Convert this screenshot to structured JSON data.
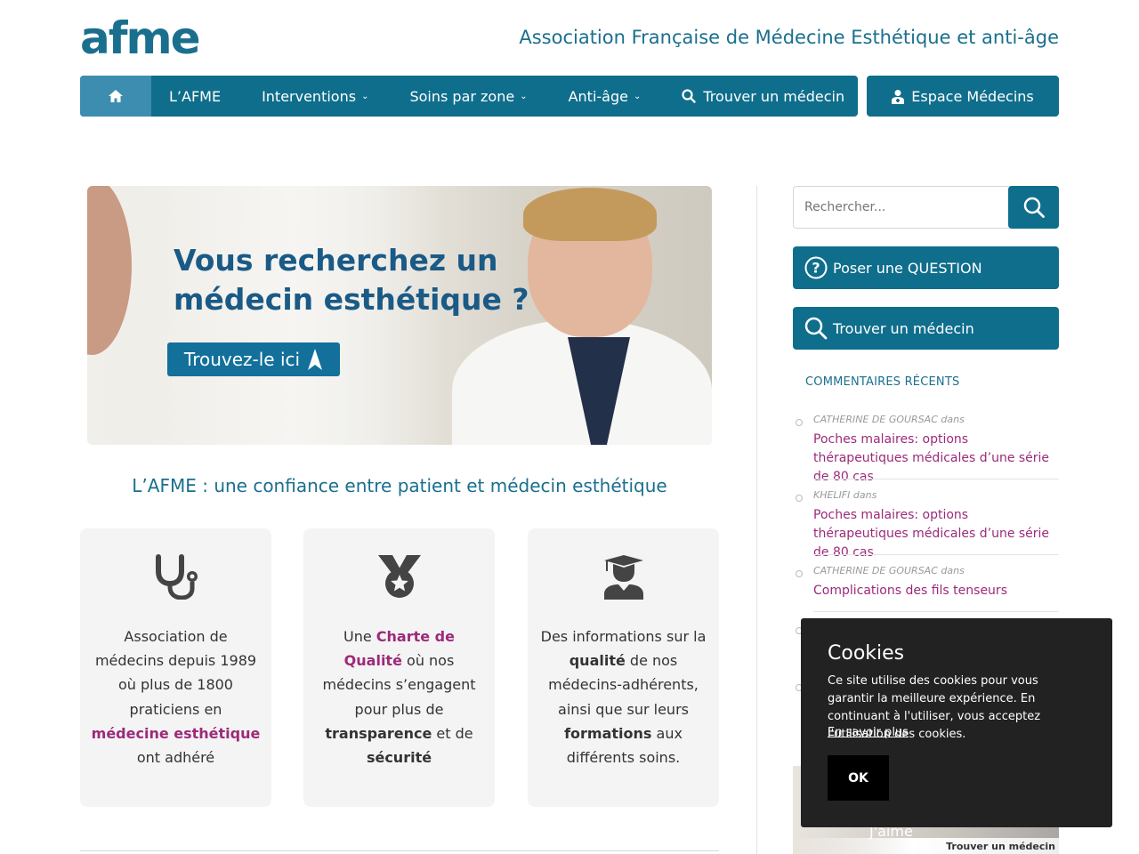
{
  "header": {
    "logo": "afme",
    "tagline": "Association Française de Médecine Esthétique et anti-âge"
  },
  "nav": {
    "items": [
      {
        "label": "L’AFME",
        "dropdown": false
      },
      {
        "label": "Interventions",
        "dropdown": true
      },
      {
        "label": "Soins par zone",
        "dropdown": true
      },
      {
        "label": "Anti-âge",
        "dropdown": true
      },
      {
        "label": "Trouver un médecin",
        "dropdown": false
      }
    ],
    "espace": "Espace Médecins"
  },
  "banner": {
    "title_line1": "Vous recherchez un",
    "title_line2": "médecin esthétique ?",
    "button": "Trouvez-le ici"
  },
  "subhead": "L’AFME : une confiance entre patient et médecin esthétique",
  "features": [
    {
      "icon": "stethoscope-icon"
    },
    {
      "icon": "medal-icon"
    },
    {
      "icon": "graduate-icon"
    }
  ],
  "sidebar": {
    "search_placeholder": "Rechercher...",
    "question_button": "Poser une QUESTION",
    "find_button": "Trouver un médecin",
    "recent_title": "COMMENTAIRES RÉCENTS",
    "comments": [
      {
        "author": "CATHERINE DE GOURSAC dans",
        "link": "Poches malaires: options thérapeutiques médicales d’une série de 80 cas"
      },
      {
        "author": "KHELIFI dans",
        "link": "Poches malaires: options thérapeutiques médicales d’une série de 80 cas"
      },
      {
        "author": "CATHERINE DE GOURSAC dans",
        "link": "Complications des fils tenseurs"
      }
    ],
    "ad_like": "J'aime",
    "ad_caption": "Trouver un médecin"
  },
  "cookie": {
    "title": "Cookies",
    "body": "Ce site utilise des cookies pour vous garantir la meilleure expérience. En continuant à l'utiliser, vous acceptez l'utilisation des cookies.",
    "more": "En savoir plus",
    "ok": "OK"
  },
  "colors": {
    "primary": "#0f6e8c",
    "accent": "#9c2a7a",
    "cookie_bg": "#222222"
  }
}
